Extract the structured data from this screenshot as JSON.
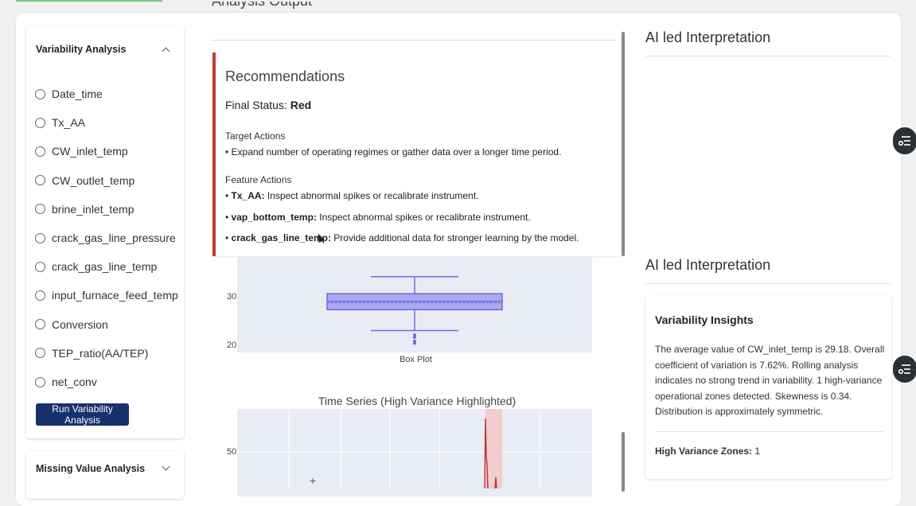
{
  "sidebar": {
    "variability_title": "Variability Analysis",
    "variables": [
      "Date_time",
      "Tx_AA",
      "CW_inlet_temp",
      "CW_outlet_temp",
      "brine_inlet_temp",
      "crack_gas_line_pressure",
      "crack_gas_line_temp",
      "input_furnace_feed_temp",
      "Conversion",
      "TEP_ratio(AA/TEP)",
      "net_conv"
    ],
    "run_button": "Run Variability Analysis",
    "missing_title": "Missing Value Analysis"
  },
  "center": {
    "title": "Analysis Output",
    "recommendations": {
      "title": "Recommendations",
      "status_label": "Final Status:",
      "status_value": "Red",
      "target_heading": "Target Actions",
      "target_items": [
        "• Expand number of operating regimes or gather data over a longer time period."
      ],
      "feature_heading": "Feature Actions",
      "feature_items": [
        {
          "bullet": "•",
          "feature": "Tx_AA:",
          "text": "Inspect abnormal spikes or recalibrate instrument."
        },
        {
          "bullet": "•",
          "feature": "vap_bottom_temp:",
          "text": "Inspect abnormal spikes or recalibrate instrument."
        },
        {
          "bullet": "•",
          "feature": "crack_gas_line_temp:",
          "text": "Provide additional data for stronger learning by the model."
        }
      ]
    },
    "boxplot": {
      "y_ticks": [
        "30",
        "20"
      ],
      "category": "Box Plot"
    },
    "timeseries": {
      "title": "Time Series (High Variance Highlighted)",
      "y_tick": "50",
      "cursor_glyph": "+"
    }
  },
  "chart_data": [
    {
      "type": "box",
      "categories": [
        "Box Plot"
      ],
      "whisker_low": 23.2,
      "q1": 27.5,
      "median": 29.2,
      "q3": 30.8,
      "whisker_high": 34.3,
      "outliers_low": [
        22.3,
        21.8,
        21.0,
        20.6
      ],
      "y_ticks": [
        20,
        30
      ]
    },
    {
      "type": "line",
      "title": "Time Series (High Variance Highlighted)",
      "y_ticks": [
        50
      ],
      "highlight_zones": 1,
      "line_color": "#c0392b",
      "highlight_color": "#f3c7c7"
    }
  ],
  "right": {
    "ai_title_1": "AI led Interpretation",
    "ai_title_2": "AI led Interpretation",
    "insight": {
      "title": "Variability Insights",
      "text": "The average value of CW_inlet_temp is 29.18. Overall coefficient of variation is 7.62%. Rolling analysis indicates no strong trend in variability. 1 high-variance operational zones detected. Skewness is 0.34. Distribution is approximately symmetric.",
      "zones_label": "High Variance Zones:",
      "zones_value": "1"
    }
  },
  "colors": {
    "accent_red": "#c63b3b",
    "button_navy": "#17316b",
    "box_fill": "#a9a9f2",
    "box_stroke": "#6c6cde"
  },
  "icons": [
    "chevron-up-icon",
    "chevron-down-icon",
    "filter-settings-icon"
  ]
}
